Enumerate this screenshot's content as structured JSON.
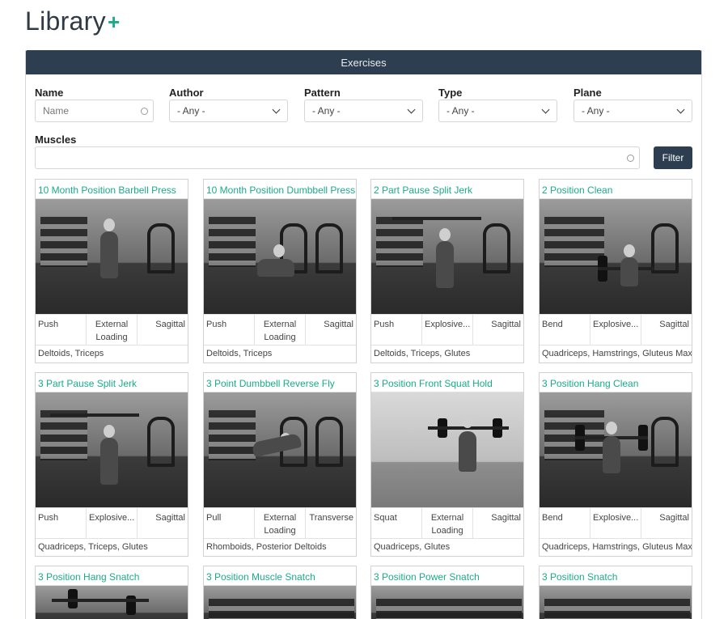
{
  "page": {
    "title": "Library",
    "add_symbol": "+"
  },
  "panel": {
    "header": "Exercises"
  },
  "filters": {
    "name_label": "Name",
    "name_placeholder": "Name",
    "author_label": "Author",
    "author_value": "- Any -",
    "pattern_label": "Pattern",
    "pattern_value": "- Any -",
    "type_label": "Type",
    "type_value": "- Any -",
    "plane_label": "Plane",
    "plane_value": "- Any -",
    "muscles_label": "Muscles",
    "filter_button": "Filter"
  },
  "cards": [
    {
      "title": "10 Month Position Barbell Press",
      "pattern": "Push",
      "type": "External Loading",
      "plane": "Sagittal",
      "muscles": "Deltoids, Triceps"
    },
    {
      "title": "10 Month Position Dumbbell Press",
      "pattern": "Push",
      "type": "External Loading",
      "plane": "Sagittal",
      "muscles": "Deltoids, Triceps"
    },
    {
      "title": "2 Part Pause Split Jerk",
      "pattern": "Push",
      "type": "Explosive...",
      "plane": "Sagittal",
      "muscles": "Deltoids, Triceps, Glutes"
    },
    {
      "title": "2 Position Clean",
      "pattern": "Bend",
      "type": "Explosive...",
      "plane": "Sagittal",
      "muscles": "Quadriceps, Hamstrings, Gluteus Max..."
    },
    {
      "title": "3 Part Pause Split Jerk",
      "pattern": "Push",
      "type": "Explosive...",
      "plane": "Sagittal",
      "muscles": "Quadriceps, Triceps, Glutes"
    },
    {
      "title": "3 Point Dumbbell Reverse Fly",
      "pattern": "Pull",
      "type": "External Loading",
      "plane": "Transverse",
      "muscles": "Rhomboids, Posterior Deltoids"
    },
    {
      "title": "3 Position Front Squat Hold",
      "pattern": "Squat",
      "type": "External Loading",
      "plane": "Sagittal",
      "muscles": "Quadriceps, Glutes"
    },
    {
      "title": "3 Position Hang Clean",
      "pattern": "Bend",
      "type": "Explosive...",
      "plane": "Sagittal",
      "muscles": "Quadriceps, Hamstrings, Gluteus Max..."
    },
    {
      "title": "3 Position Hang Snatch"
    },
    {
      "title": "3 Position Muscle Snatch"
    },
    {
      "title": "3 Position Power Snatch"
    },
    {
      "title": "3 Position Snatch"
    }
  ]
}
